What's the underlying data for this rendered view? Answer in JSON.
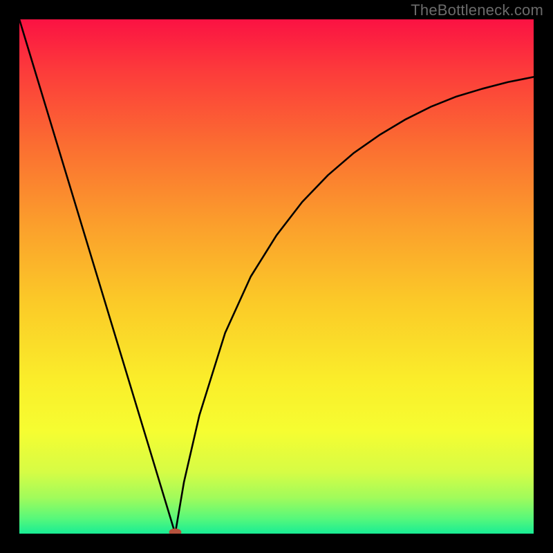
{
  "watermark": "TheBottleneck.com",
  "chart_data": {
    "type": "line",
    "title": "",
    "xlabel": "",
    "ylabel": "",
    "xlim": [
      0,
      1
    ],
    "ylim": [
      0,
      1
    ],
    "legend": false,
    "grid": false,
    "background": "rainbow-vertical-gradient (red→orange→yellow→green)",
    "series": [
      {
        "name": "left-branch",
        "x": [
          0.0,
          0.05,
          0.1,
          0.15,
          0.2,
          0.25,
          0.3,
          0.303
        ],
        "values": [
          1.0,
          0.835,
          0.67,
          0.505,
          0.34,
          0.175,
          0.01,
          0.0
        ]
      },
      {
        "name": "right-branch",
        "x": [
          0.303,
          0.32,
          0.35,
          0.4,
          0.45,
          0.5,
          0.55,
          0.6,
          0.65,
          0.7,
          0.75,
          0.8,
          0.85,
          0.9,
          0.95,
          1.0
        ],
        "values": [
          0.0,
          0.1,
          0.23,
          0.39,
          0.5,
          0.58,
          0.645,
          0.697,
          0.74,
          0.775,
          0.805,
          0.83,
          0.85,
          0.865,
          0.878,
          0.888
        ]
      }
    ],
    "marker": {
      "x": 0.303,
      "y": 0.003,
      "rx": 0.012,
      "ry": 0.007,
      "color": "#b6523d"
    },
    "gradient_stops": [
      {
        "offset": 0.0,
        "color": "#fb1243"
      },
      {
        "offset": 0.1,
        "color": "#fc3b3b"
      },
      {
        "offset": 0.25,
        "color": "#fb6f31"
      },
      {
        "offset": 0.4,
        "color": "#fb9f2c"
      },
      {
        "offset": 0.55,
        "color": "#fbca28"
      },
      {
        "offset": 0.7,
        "color": "#faed2a"
      },
      {
        "offset": 0.8,
        "color": "#f6fd31"
      },
      {
        "offset": 0.88,
        "color": "#d6fc45"
      },
      {
        "offset": 0.93,
        "color": "#a1fb5b"
      },
      {
        "offset": 0.97,
        "color": "#58f87a"
      },
      {
        "offset": 1.0,
        "color": "#18ed95"
      }
    ]
  }
}
